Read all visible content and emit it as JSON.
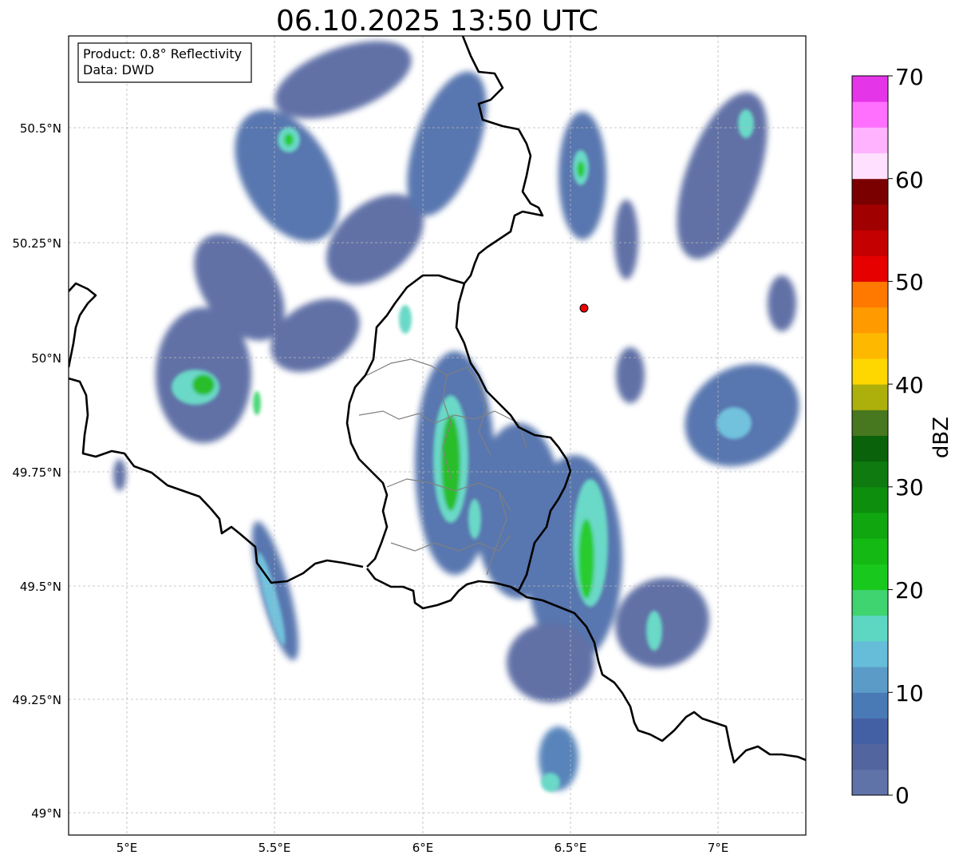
{
  "title": "06.10.2025 13:50 UTC",
  "info_box": {
    "line1": "Product: 0.8° Reflectivity",
    "line2": "Data: DWD"
  },
  "axes": {
    "x_ticks": [
      "5°E",
      "5.5°E",
      "6°E",
      "6.5°E",
      "7°E"
    ],
    "y_ticks": [
      "50.5°N",
      "50.25°N",
      "50°N",
      "49.75°N",
      "49.5°N",
      "49.25°N",
      "49°N"
    ]
  },
  "colorbar": {
    "label": "dBZ",
    "ticks": [
      "0",
      "10",
      "20",
      "30",
      "40",
      "50",
      "60",
      "70"
    ],
    "colors": [
      "#6073a8",
      "#52659f",
      "#4460a5",
      "#4a7ab5",
      "#5b9bc8",
      "#66bdda",
      "#5dd6c2",
      "#3fd470",
      "#19c81c",
      "#14b914",
      "#10a610",
      "#0d8f0d",
      "#0e7a10",
      "#0a620a",
      "#47771e",
      "#adb00b",
      "#ffd700",
      "#ffb800",
      "#ff9a00",
      "#ff7800",
      "#e60000",
      "#c40000",
      "#a10000",
      "#7a0000",
      "#ffe0ff",
      "#ffb3ff",
      "#ff70ff",
      "#e535e8"
    ]
  },
  "map": {
    "radar_site_color": "#ee0000",
    "grid_color": "#b8b8b8",
    "border_color": "#000000",
    "district_color": "#808080"
  }
}
